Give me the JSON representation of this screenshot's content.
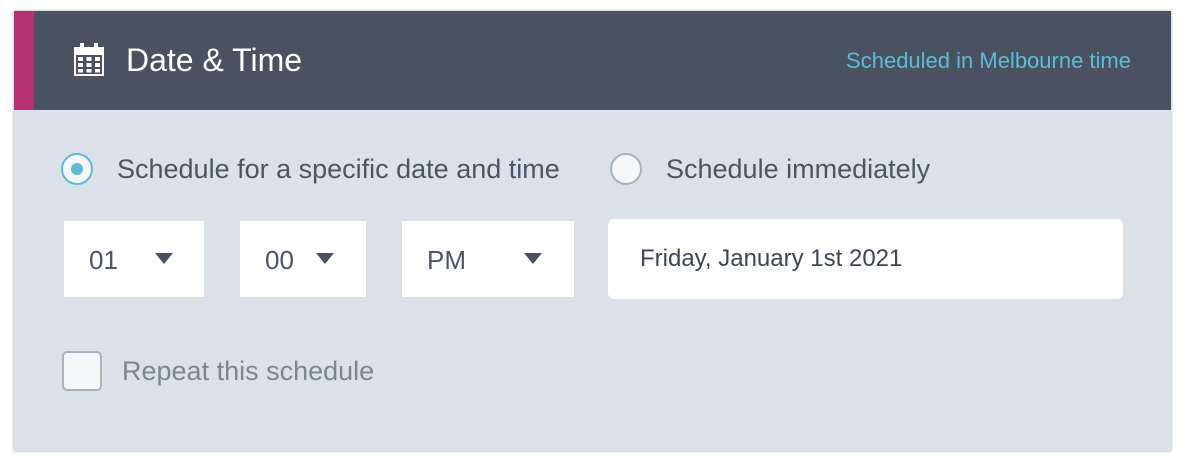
{
  "header": {
    "title": "Date & Time",
    "note": "Scheduled in Melbourne time",
    "icon": "calendar-icon",
    "accent_color": "#b7306f",
    "background_color": "#4a5262"
  },
  "schedule_options": {
    "specific": {
      "label": "Schedule for a specific date and time",
      "selected": true
    },
    "immediate": {
      "label": "Schedule immediately",
      "selected": false
    }
  },
  "time": {
    "hour": "01",
    "minute": "00",
    "period": "PM"
  },
  "date": {
    "value": "Friday, January 1st 2021"
  },
  "repeat": {
    "label": "Repeat this schedule",
    "checked": false
  },
  "colors": {
    "accent": "#5bbdd3",
    "panel_background": "#dae1e8"
  }
}
